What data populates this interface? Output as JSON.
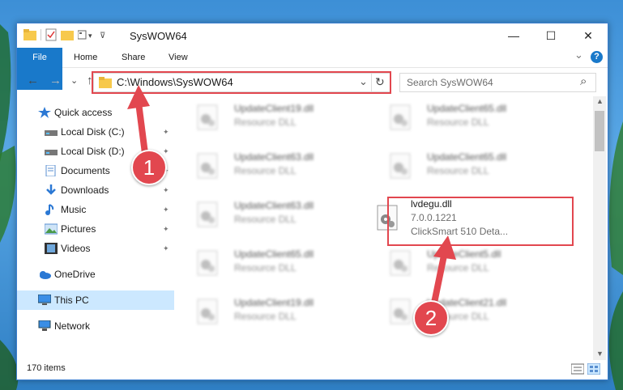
{
  "window": {
    "title": "SysWOW64",
    "min_glyph": "—",
    "max_glyph": "☐",
    "close_glyph": "✕"
  },
  "ribbon": {
    "tabs": [
      "File",
      "Home",
      "Share",
      "View"
    ],
    "chevron_glyph": "⌄",
    "help_glyph": "?"
  },
  "nav": {
    "back_glyph": "←",
    "forward_glyph": "→",
    "recent_glyph": "⌄",
    "up_glyph": "↑",
    "address": "C:\\Windows\\SysWOW64",
    "address_dropdown_glyph": "⌄",
    "refresh_glyph": "↻",
    "search_placeholder": "Search SysWOW64",
    "search_glyph": "⌕"
  },
  "sidebar": {
    "items": [
      {
        "label": "Quick access",
        "icon": "star-icon"
      },
      {
        "label": "Local Disk (C:)",
        "icon": "drive-icon",
        "pinned": true
      },
      {
        "label": "Local Disk (D:)",
        "icon": "drive-icon",
        "pinned": true
      },
      {
        "label": "Documents",
        "icon": "documents-icon",
        "pinned": true
      },
      {
        "label": "Downloads",
        "icon": "download-icon",
        "pinned": true
      },
      {
        "label": "Music",
        "icon": "music-icon",
        "pinned": true
      },
      {
        "label": "Pictures",
        "icon": "pictures-icon",
        "pinned": true
      },
      {
        "label": "Videos",
        "icon": "videos-icon",
        "pinned": true
      },
      {
        "label": "OneDrive",
        "icon": "cloud-icon"
      },
      {
        "label": "This PC",
        "icon": "computer-icon",
        "selected": true
      },
      {
        "label": "Network",
        "icon": "network-icon"
      }
    ],
    "pin_glyph": "📌"
  },
  "files": [
    {
      "name": "UpdateClient19.dll",
      "desc": "Resource DLL"
    },
    {
      "name": "UpdateClient65.dll",
      "desc": "Resource DLL"
    },
    {
      "name": "UpdateClient63.dll",
      "desc": "Resource DLL"
    },
    {
      "name": "UpdateClient65.dll",
      "desc": "Resource DLL"
    },
    {
      "name": "UpdateClient63.dll",
      "desc": "Resource DLL"
    },
    {
      "name": "lvdegu.dll",
      "version": "7.0.0.1221",
      "desc": "ClickSmart 510 Deta..."
    },
    {
      "name": "UpdateClient65.dll",
      "desc": "Resource DLL"
    },
    {
      "name": "UpdateClient5.dll",
      "desc": "Resource DLL"
    },
    {
      "name": "UpdateClient19.dll",
      "desc": "Resource DLL"
    },
    {
      "name": "UpdateClient21.dll",
      "desc": "Resource DLL"
    }
  ],
  "status": {
    "count": "170 items"
  },
  "annotations": {
    "step1": "1",
    "step2": "2",
    "color": "#e2474f"
  },
  "colors": {
    "accent": "#1979ca",
    "selected": "#cce8ff",
    "folder": "#f7c94c"
  }
}
